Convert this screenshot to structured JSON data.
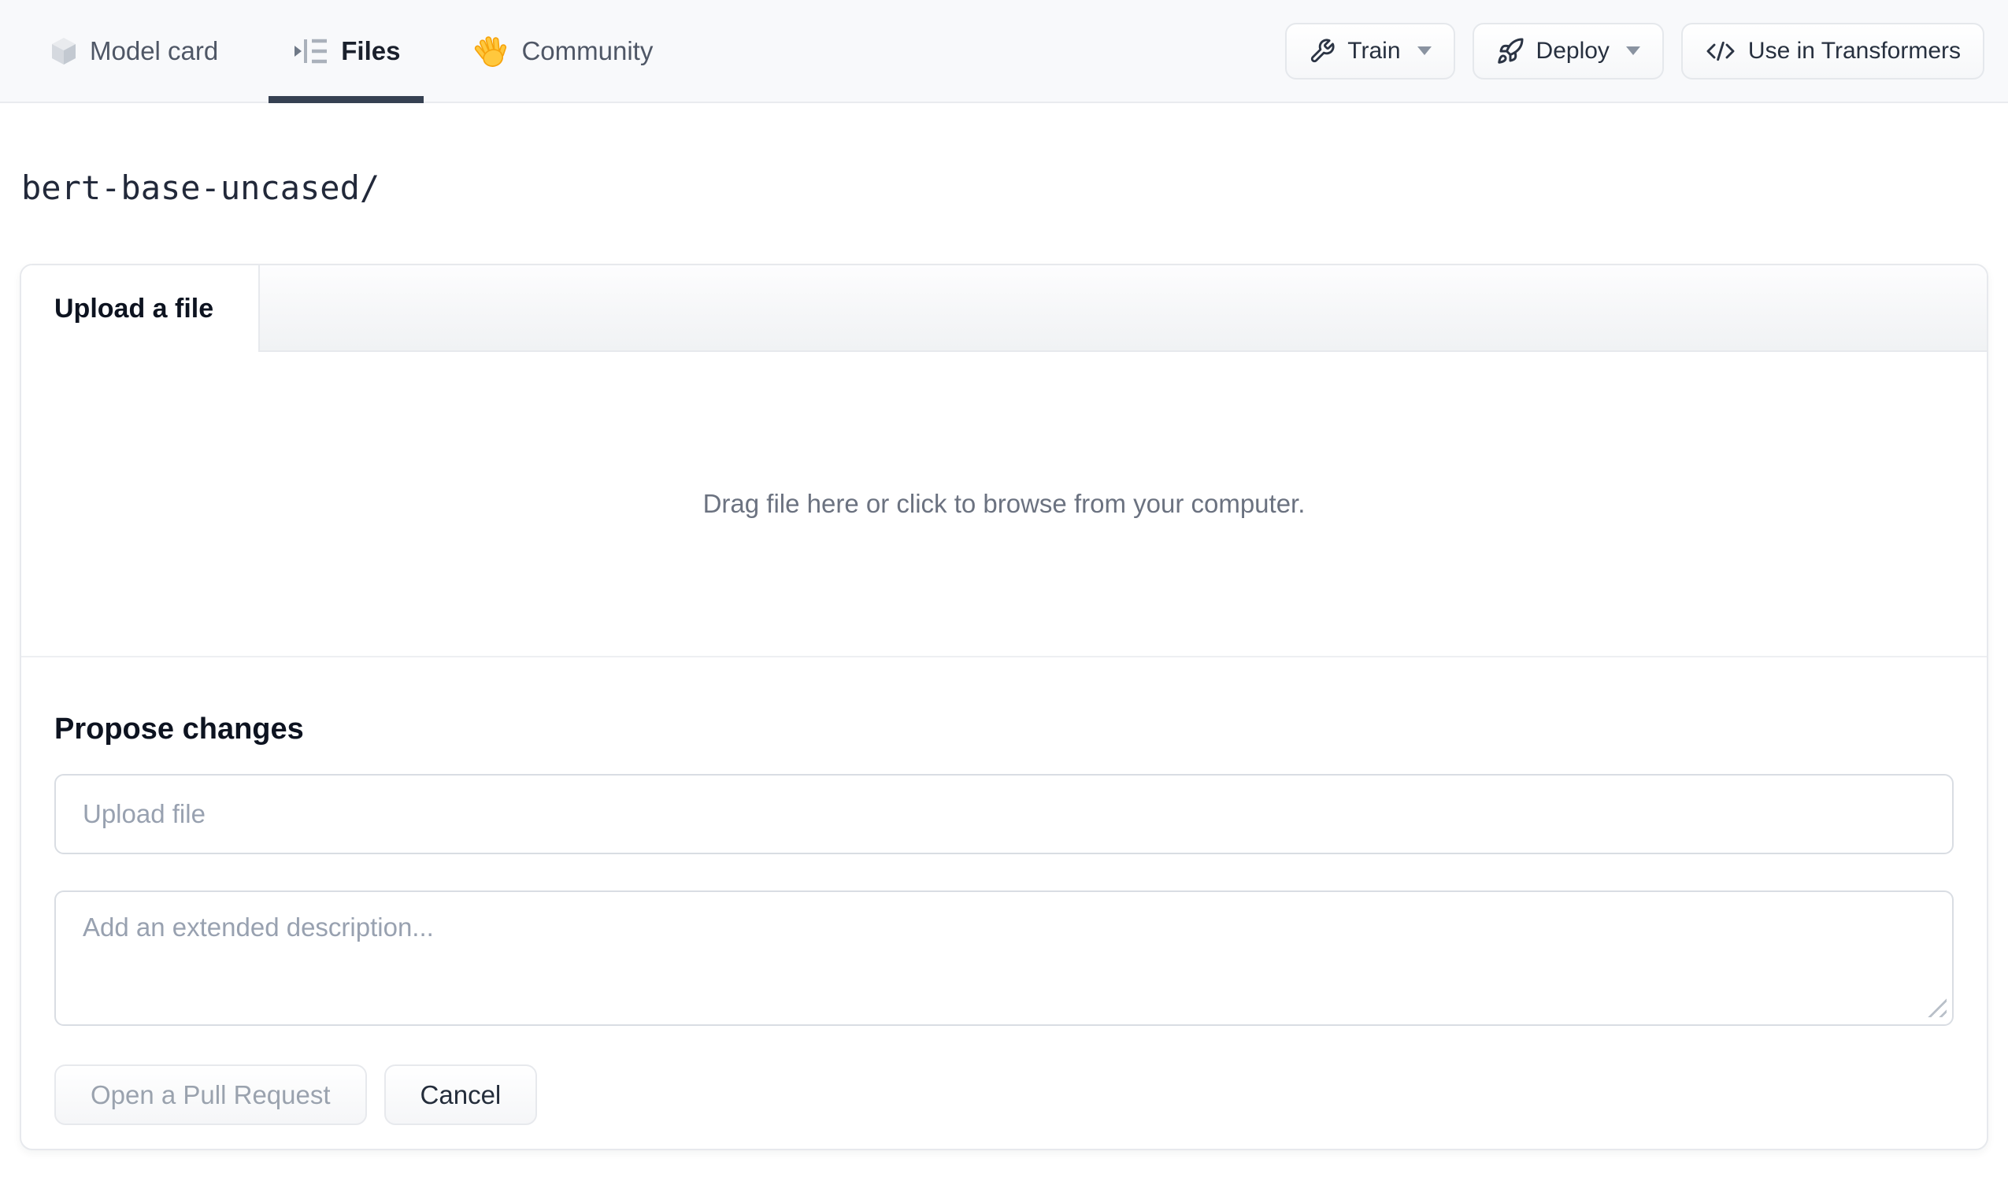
{
  "nav": {
    "tabs": [
      {
        "label": "Model card",
        "icon": "cube-icon",
        "active": false
      },
      {
        "label": "Files",
        "icon": "files-icon",
        "active": true
      },
      {
        "label": "Community",
        "icon": "waving-hand-icon",
        "active": false
      }
    ],
    "actions": [
      {
        "label": "Train",
        "icon": "wrench-icon",
        "has_caret": true
      },
      {
        "label": "Deploy",
        "icon": "rocket-icon",
        "has_caret": true
      },
      {
        "label": "Use in Transformers",
        "icon": "code-icon",
        "has_caret": false
      }
    ]
  },
  "breadcrumb": {
    "path": "bert-base-uncased/"
  },
  "upload_card": {
    "tab_label": "Upload a file",
    "dropzone_text": "Drag file here or click to browse from your computer.",
    "propose": {
      "heading": "Propose changes",
      "file_input_placeholder": "Upload file",
      "description_placeholder": "Add an extended description...",
      "primary_button": "Open a Pull Request",
      "cancel_button": "Cancel"
    }
  },
  "colors": {
    "nav_background": "#f8f9fb",
    "active_tab_underline": "#364152",
    "active_tab_text": "#1a202c",
    "inactive_tab_text": "#4f5766",
    "button_border": "#e5e8ec",
    "card_border": "#e7e9ed",
    "input_border": "#d9dde3",
    "placeholder_text": "#98a1b0",
    "dropzone_text": "#6b7280",
    "disabled_button_text": "#9aa2ae",
    "hand_emoji_yellow": "#ffc83d"
  }
}
